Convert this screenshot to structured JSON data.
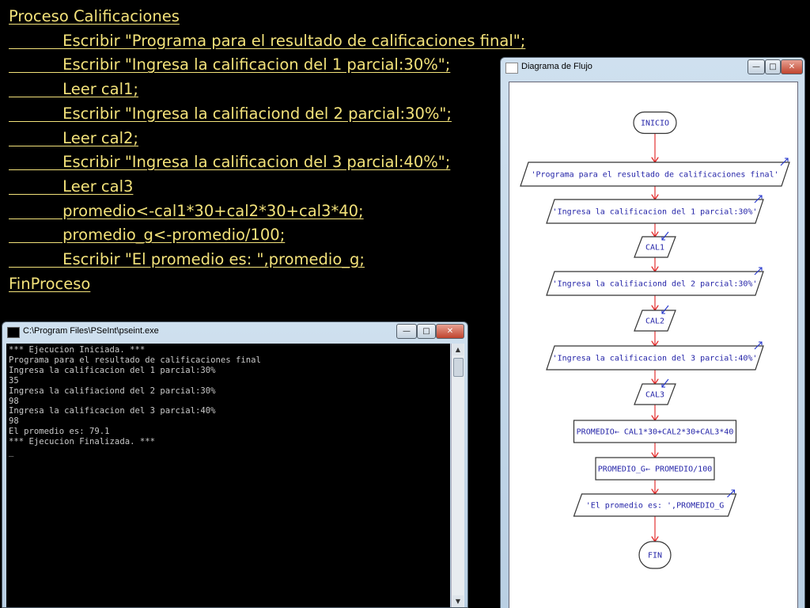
{
  "code_lines": [
    "Proceso Calificaciones",
    "           Escribir \"Programa para el resultado de calificaciones final\";",
    "           Escribir \"Ingresa la calificacion del 1 parcial:30%\";",
    "           Leer cal1;",
    "           Escribir \"Ingresa la califiaciond del 2 parcial:30%\";",
    "           Leer cal2;",
    "           Escribir \"Ingresa la calificacion del 3 parcial:40%\";",
    "           Leer cal3",
    "           promedio<-cal1*30+cal2*30+cal3*40;",
    "           promedio_g<-promedio/100;",
    "           Escribir \"El promedio es: \",promedio_g;",
    "FinProceso"
  ],
  "console_window": {
    "title": "C:\\Program Files\\PSeInt\\pseint.exe",
    "icon": "console-icon",
    "buttons": {
      "minimize": "—",
      "maximize": "□",
      "close": "✕"
    },
    "lines": [
      "*** Ejecucion Iniciada. ***",
      "Programa para el resultado de calificaciones final",
      "Ingresa la calificacion del 1 parcial:30%",
      "35",
      "Ingresa la califiaciond del 2 parcial:30%",
      "98",
      "Ingresa la calificacion del 3 parcial:40%",
      "98",
      "El promedio es: 79.1",
      "*** Ejecucion Finalizada. ***",
      "_"
    ]
  },
  "flow_window": {
    "title": "Diagrama de Flujo",
    "icon": "diagram-icon",
    "buttons": {
      "minimize": "—",
      "maximize": "□",
      "close": "✕"
    },
    "nodes": [
      {
        "kind": "terminal",
        "text": "INICIO"
      },
      {
        "kind": "output",
        "text": "'Programa para el resultado de calificaciones final'"
      },
      {
        "kind": "output",
        "text": "'Ingresa la calificacion del 1 parcial:30%'"
      },
      {
        "kind": "input",
        "text": "CAL1"
      },
      {
        "kind": "output",
        "text": "'Ingresa la califiaciond del 2 parcial:30%'"
      },
      {
        "kind": "input",
        "text": "CAL2"
      },
      {
        "kind": "output",
        "text": "'Ingresa la calificacion del 3 parcial:40%'"
      },
      {
        "kind": "input",
        "text": "CAL3"
      },
      {
        "kind": "process",
        "text": "PROMEDIO← CAL1*30+CAL2*30+CAL3*40"
      },
      {
        "kind": "process",
        "text": "PROMEDIO_G← PROMEDIO/100"
      },
      {
        "kind": "output",
        "text": "'El promedio es: ',PROMEDIO_G"
      },
      {
        "kind": "terminal",
        "text": "FIN"
      }
    ]
  },
  "colors": {
    "background": "#000000",
    "code_text": "#f3e27a",
    "console_text": "#c8c8c8",
    "flow_arrow": "#e02020",
    "flow_text": "#2424a8"
  }
}
